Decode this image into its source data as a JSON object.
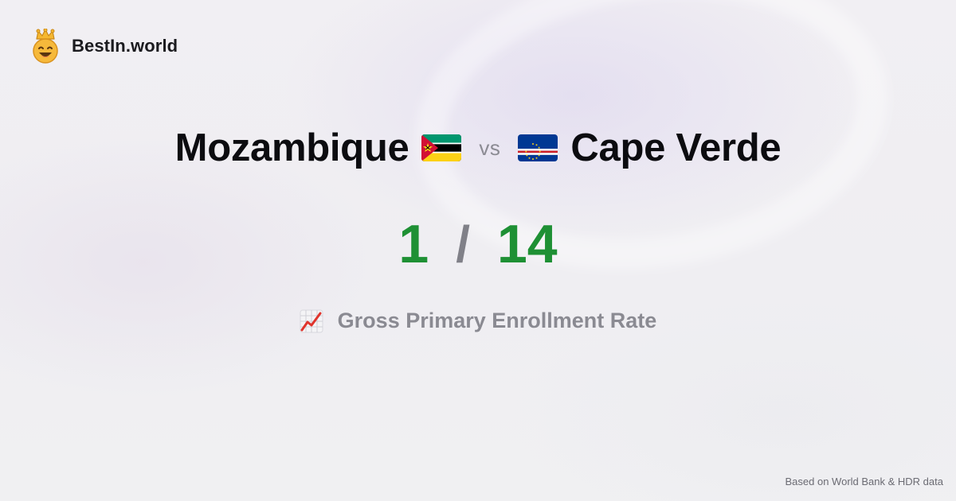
{
  "brand": {
    "name": "BestIn.world",
    "logo_icon": "crown-smiley-icon"
  },
  "comparison": {
    "left_country": "Mozambique",
    "left_flag_icon": "mozambique-flag-icon",
    "separator": "vs",
    "right_country": "Cape Verde",
    "right_flag_icon": "cape-verde-flag-icon"
  },
  "score": {
    "left": "1",
    "divider": "/",
    "right": "14",
    "value_color": "#1e9034"
  },
  "metric": {
    "icon": "chart-increasing-icon",
    "label": "Gross Primary Enrollment Rate"
  },
  "footer": {
    "source": "Based on World Bank & HDR data"
  }
}
